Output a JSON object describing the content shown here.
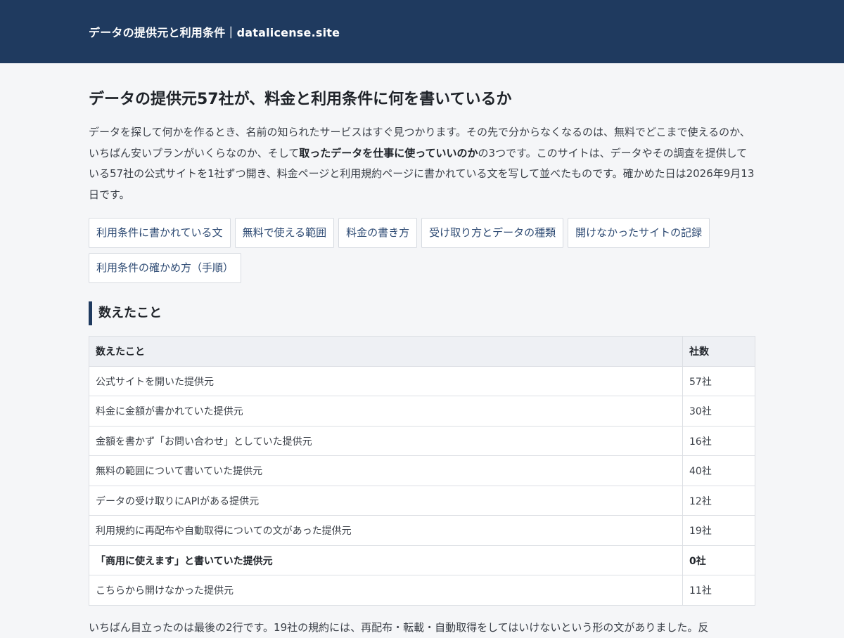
{
  "header": {
    "site_title": "データの提供元と利用条件｜datalicense.site"
  },
  "main": {
    "title": "データの提供元57社が、料金と利用条件に何を書いているか",
    "lead": {
      "part1": "データを探して何かを作るとき、名前の知られたサービスはすぐ見つかります。その先で分からなくなるのは、無料でどこまで使えるのか、いちばん安いプランがいくらなのか、そして",
      "strong": "取ったデータを仕事に使っていいのか",
      "part2": "の3つです。このサイトは、データやその調査を提供している57社の公式サイトを1社ずつ開き、料金ページと利用規約ページに書かれている文を写して並べたものです。確かめた日は2026年9月13日です。"
    },
    "nav_links": [
      "利用条件に書かれている文",
      "無料で使える範囲",
      "料金の書き方",
      "受け取り方とデータの種類",
      "開けなかったサイトの記録",
      "利用条件の確かめ方（手順）"
    ],
    "section_heading": "数えたこと",
    "table": {
      "headers": [
        "数えたこと",
        "社数"
      ],
      "rows": [
        {
          "item": "公式サイトを開いた提供元",
          "count": "57社"
        },
        {
          "item": "料金に金額が書かれていた提供元",
          "count": "30社"
        },
        {
          "item": "金額を書かず「お問い合わせ」としていた提供元",
          "count": "16社"
        },
        {
          "item": "無料の範囲について書いていた提供元",
          "count": "40社"
        },
        {
          "item": "データの受け取りにAPIがある提供元",
          "count": "12社"
        },
        {
          "item": "利用規約に再配布や自動取得についての文があった提供元",
          "count": "19社"
        },
        {
          "item": "「商用に使えます」と書いていた提供元",
          "count": "0社"
        },
        {
          "item": "こちらから開けなかった提供元",
          "count": "11社"
        }
      ]
    },
    "after_text": "いちばん目立ったのは最後の2行です。19社の規約には、再配布・転載・自動取得をしてはいけないという形の文がありました。反"
  }
}
